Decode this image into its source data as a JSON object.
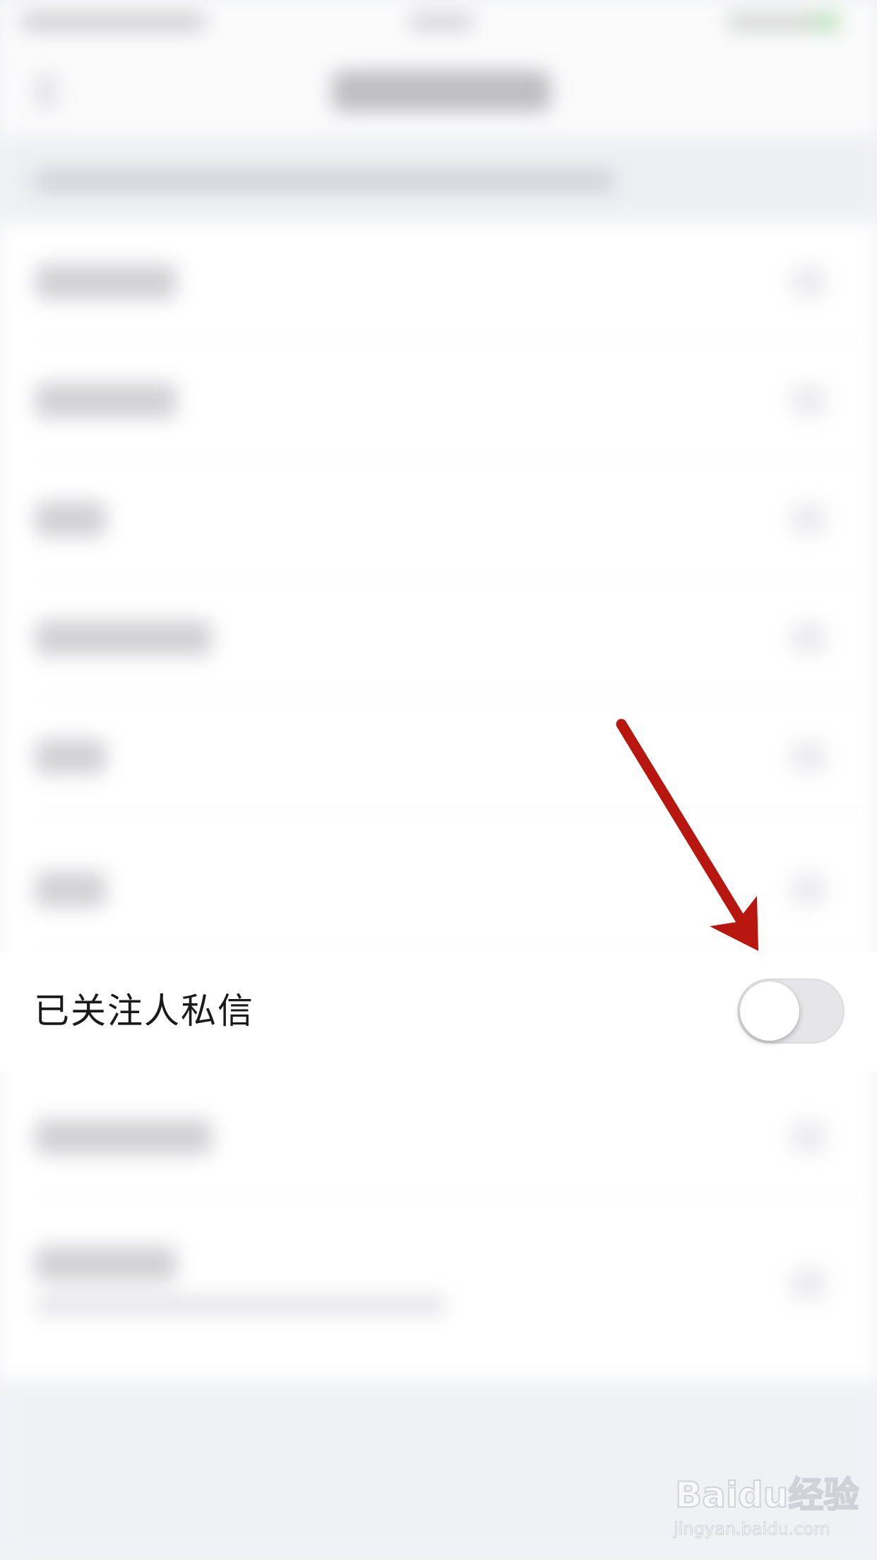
{
  "setting": {
    "label": "已关注人私信",
    "toggle_on": false
  },
  "watermark": {
    "logo": "Baidu经验",
    "url": "jingyan.baidu.com"
  },
  "colors": {
    "annotation_arrow": "#b7170f",
    "toggle_off_track": "#e6e6e8",
    "text": "#1a1a1a"
  },
  "icons": {
    "annotation": "red-arrow-icon",
    "toggle": "toggle-switch"
  }
}
